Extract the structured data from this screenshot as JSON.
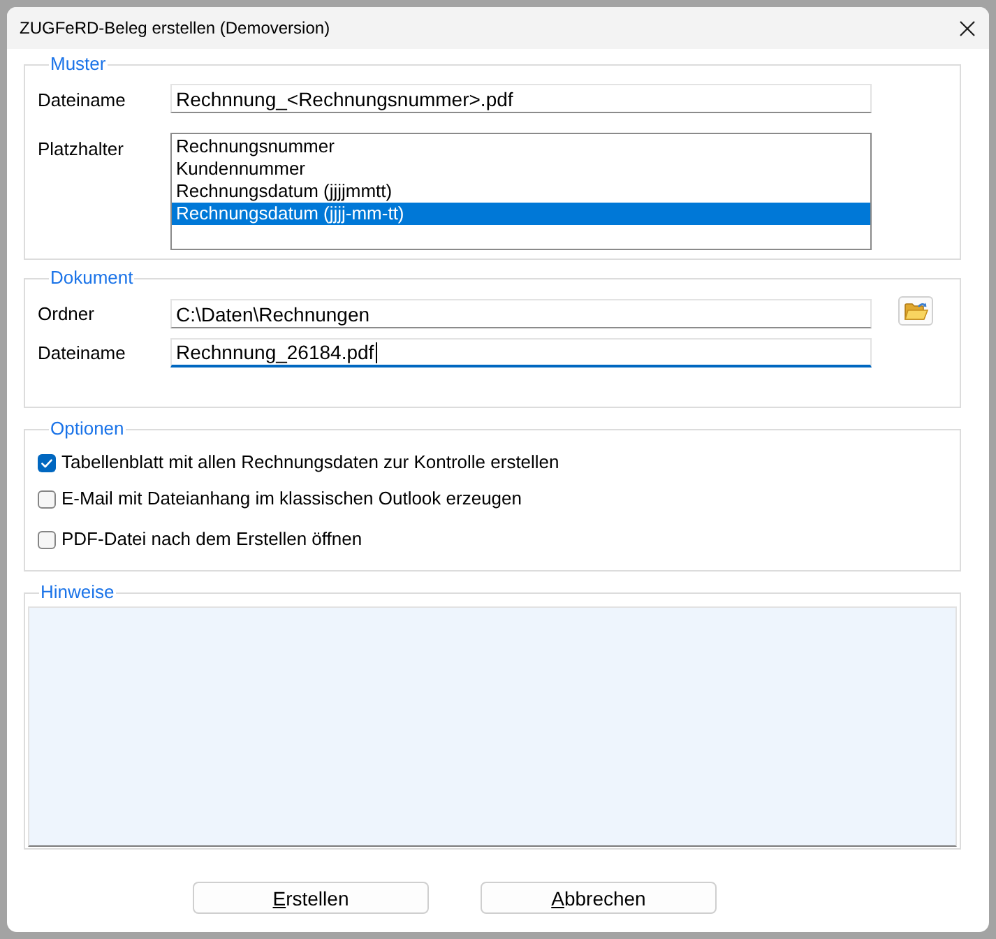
{
  "window": {
    "title": "ZUGFeRD-Beleg erstellen (Demoversion)"
  },
  "muster": {
    "legend": "Muster",
    "filename": {
      "label": "Dateiname",
      "value": "Rechnnung_<Rechnungsnummer>.pdf",
      "focused": false
    },
    "placeholders": {
      "label": "Platzhalter",
      "items": [
        {
          "label": "Rechnungsnummer",
          "selected": false
        },
        {
          "label": "Kundennummer",
          "selected": false
        },
        {
          "label": "Rechnungsdatum (jjjjmmtt)",
          "selected": false
        },
        {
          "label": "Rechnungsdatum (jjjj-mm-tt)",
          "selected": true
        }
      ]
    }
  },
  "dokument": {
    "legend": "Dokument",
    "fields": [
      {
        "label": "Ordner",
        "value": "C:\\Daten\\Rechnungen",
        "focused": false,
        "browse_button": true
      },
      {
        "label": "Dateiname",
        "value": "Rechnnung_26184.pdf",
        "focused": true,
        "browse_button": false
      }
    ]
  },
  "optionen": {
    "legend": "Optionen",
    "options": [
      {
        "label": "Tabellenblatt mit allen Rechnungsdaten zur Kontrolle erstellen",
        "checked": true
      },
      {
        "label": "E-Mail mit Dateianhang im klassischen Outlook erzeugen",
        "checked": false
      },
      {
        "label": "PDF-Datei nach dem Erstellen öffnen",
        "checked": false
      }
    ]
  },
  "hinweise": {
    "legend": "Hinweise"
  },
  "buttons": [
    {
      "label": "Erstellen",
      "accelerator_underlined": true
    },
    {
      "label": "Abbrechen",
      "accelerator_underlined": true
    }
  ]
}
